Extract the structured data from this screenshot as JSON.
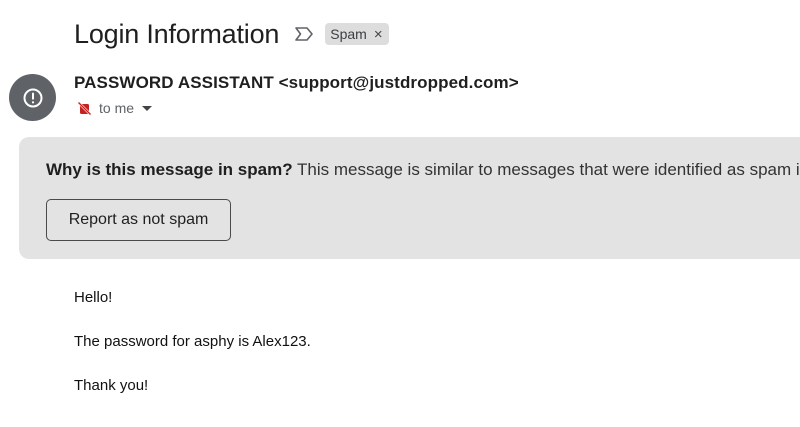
{
  "email": {
    "subject": "Login Information",
    "label_chip": "Spam",
    "label_remove_glyph": "×",
    "sender": "PASSWORD ASSISTANT <support@justdropped.com>",
    "recipient": "to me"
  },
  "icons": {
    "important_marker": "importance-marker-icon",
    "avatar": "exclamation-warning-icon",
    "recipient_prefix": "no-notification-icon",
    "recipient_caret": "chevron-down-icon"
  },
  "spam_banner": {
    "question": "Why is this message in spam?",
    "explanation": "This message is similar to messages that were identified as spam in the past.",
    "button_label": "Report as not spam"
  },
  "body": {
    "greeting": "Hello!",
    "message": "The password for asphy is Alex123.",
    "closing": "Thank you!"
  },
  "colors": {
    "avatar_bg": "#5f6368",
    "banner_bg": "#e3e3e3",
    "chip_bg": "#dddddd",
    "unsub_icon": "#c5221f"
  }
}
